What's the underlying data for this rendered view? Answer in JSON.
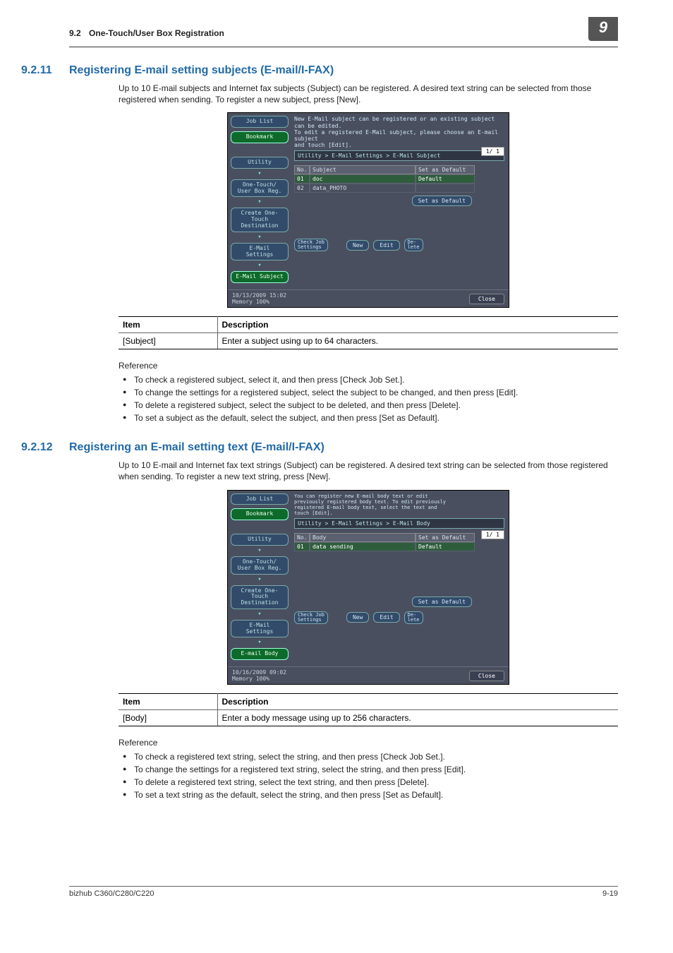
{
  "header": {
    "section_no": "9.2",
    "section_title": "One-Touch/User Box Registration",
    "chapter_tab": "9"
  },
  "sec1": {
    "num": "9.2.11",
    "title": "Registering E-mail setting subjects (E-mail/I-FAX)",
    "intro": "Up to 10 E-mail subjects and Internet fax subjects (Subject) can be registered. A desired text string can be selected from those registered when sending. To register a new subject, press [New].",
    "table": {
      "h_item": "Item",
      "h_desc": "Description",
      "r1_item": "[Subject]",
      "r1_desc": "Enter a subject using up to 64 characters."
    },
    "ref_label": "Reference",
    "bullets": {
      "b1": "To check a registered subject, select it, and then press [Check Job Set.].",
      "b2": "To change the settings for a registered subject, select the subject to be changed, and then press [Edit].",
      "b3": "To delete a registered subject, select the subject to be deleted, and then press [Delete].",
      "b4": "To set a subject as the default, select the subject, and then press [Set as Default]."
    },
    "shot": {
      "side": {
        "job_list": "Job List",
        "bookmark": "Bookmark",
        "utility": "Utility",
        "onetouch": "One-Touch/\nUser Box Reg.",
        "create": "Create One-Touch\nDestination",
        "email_settings": "E-Mail\nSettings",
        "current": "E-Mail Subject"
      },
      "msg": "New E-Mail subject can be registered or an existing subject can be edited.\nTo edit a registered E-Mail subject, please choose an E-mail subject\nand touch [Edit].",
      "path": "Utility > E-Mail Settings > E-Mail Subject",
      "cols": {
        "no": "No.",
        "subject": "Subject",
        "default": "Set as Default"
      },
      "rows": [
        {
          "no": "01",
          "subject": "doc",
          "default": "Default",
          "sel": true
        },
        {
          "no": "02",
          "subject": "data_PHOTO",
          "default": "",
          "sel": false
        }
      ],
      "page_tag": "1/  1",
      "set_default_btn": "Set as Default",
      "btns": {
        "check": "Check Job\nSettings",
        "new": "New",
        "edit": "Edit",
        "delete": "De-\nlete"
      },
      "status": {
        "dt": "10/13/2009   15:02",
        "mem": "Memory      100%",
        "close": "Close"
      }
    }
  },
  "sec2": {
    "num": "9.2.12",
    "title": "Registering an E-mail setting text (E-mail/I-FAX)",
    "intro": "Up to 10 E-mail and Internet fax text strings (Subject) can be registered. A desired text string can be selected from those registered when sending. To register a new text string, press [New].",
    "table": {
      "h_item": "Item",
      "h_desc": "Description",
      "r1_item": "[Body]",
      "r1_desc": "Enter a body message using up to 256 characters."
    },
    "ref_label": "Reference",
    "bullets": {
      "b1": "To check a registered text string, select the string, and then press [Check Job Set.].",
      "b2": "To change the settings for a registered text string, select the string, and then press [Edit].",
      "b3": "To delete a registered text string, select the text string, and then press [Delete].",
      "b4": "To set a text string as the default, select the string, and then press [Set as Default]."
    },
    "shot": {
      "side": {
        "job_list": "Job List",
        "bookmark": "Bookmark",
        "utility": "Utility",
        "onetouch": "One-Touch/\nUser Box Reg.",
        "create": "Create One-Touch\nDestination",
        "email_settings": "E-Mail\nSettings",
        "current": "E-mail Body"
      },
      "msg": "You can register new E-mail body text or edit\npreviously registered body text. To edit previously\nregistered E-mail body text, select the text and\ntouch [Edit].",
      "path": "Utility > E-Mail Settings > E-Mail Body",
      "cols": {
        "no": "No.",
        "subject": "Body",
        "default": "Set as Default"
      },
      "rows": [
        {
          "no": "01",
          "subject": "data sending",
          "default": "Default",
          "sel": true
        }
      ],
      "page_tag": "1/  1",
      "set_default_btn": "Set as Default",
      "btns": {
        "check": "Check Job\nSettings",
        "new": "New",
        "edit": "Edit",
        "delete": "De-\nlete"
      },
      "status": {
        "dt": "10/16/2009   09:02",
        "mem": "Memory      100%",
        "close": "Close"
      }
    }
  },
  "footer": {
    "model": "bizhub C360/C280/C220",
    "page": "9-19"
  }
}
